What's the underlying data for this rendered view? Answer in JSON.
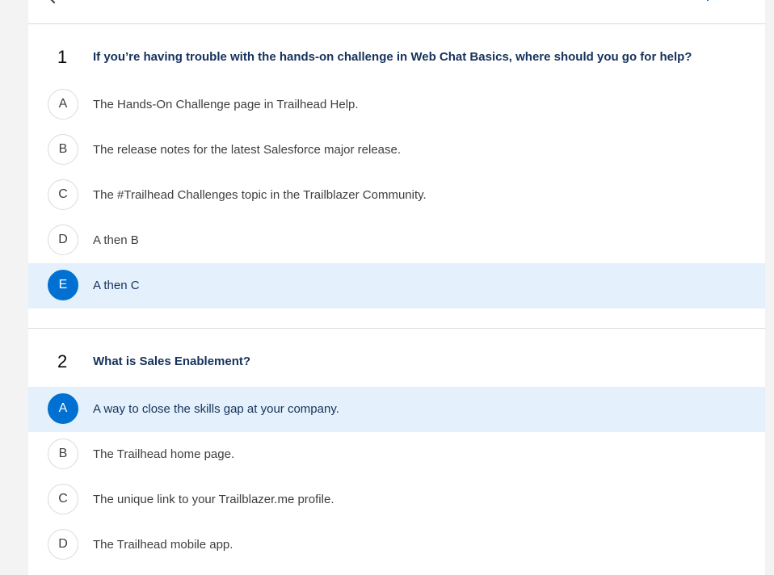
{
  "questions": [
    {
      "number": "1",
      "text": "If you’re having trouble with the hands-on challenge in Web Chat Basics, where should you go for help?",
      "options": [
        {
          "letter": "A",
          "text": "The Hands-On Challenge page in Trailhead Help.",
          "selected": false
        },
        {
          "letter": "B",
          "text": "The release notes for the latest Salesforce major release.",
          "selected": false
        },
        {
          "letter": "C",
          "text": "The #Trailhead Challenges topic in the Trailblazer Community.",
          "selected": false
        },
        {
          "letter": "D",
          "text": "A then B",
          "selected": false
        },
        {
          "letter": "E",
          "text": "A then C",
          "selected": true
        }
      ]
    },
    {
      "number": "2",
      "text": "What is Sales Enablement?",
      "options": [
        {
          "letter": "A",
          "text": "A way to close the skills gap at your company.",
          "selected": true
        },
        {
          "letter": "B",
          "text": "The Trailhead home page.",
          "selected": false
        },
        {
          "letter": "C",
          "text": "The unique link to your Trailblazer.me profile.",
          "selected": false
        },
        {
          "letter": "D",
          "text": "The Trailhead mobile app.",
          "selected": false
        }
      ]
    }
  ],
  "colors": {
    "accent": "#0070d2",
    "selected_row": "#e4f1fc",
    "question_text": "#16325c",
    "option_text": "#3e3e3c",
    "border": "#dddbda"
  }
}
